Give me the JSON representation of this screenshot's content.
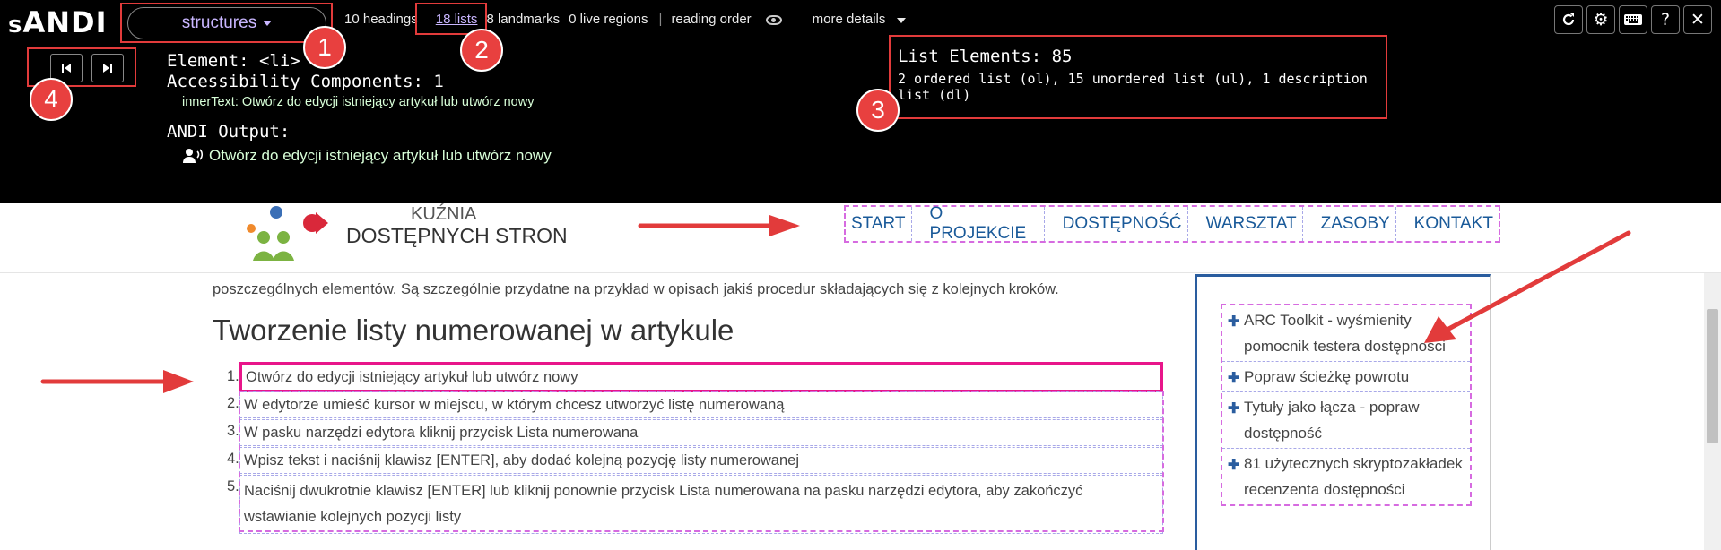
{
  "andi": {
    "logo_prefix": "s",
    "logo_main": "ANDI",
    "module": "structures",
    "summary": {
      "headings": "10 headings",
      "lists": "18 lists",
      "landmarks": "8 landmarks",
      "live_regions": "0 live regions",
      "reading_order": "reading order",
      "more_details": "more details"
    },
    "toolbar_icons": [
      "refresh-icon",
      "settings-icon",
      "keyboard-icon",
      "help-icon",
      "close-icon"
    ],
    "element_label": "Element: <li>",
    "components_label": "Accessibility Components: 1",
    "inner_text": "innerText: Otwórz do edycji istniejący artykuł lub utwórz nowy",
    "output_label": "ANDI Output:",
    "output_text": "Otwórz do edycji istniejący artykuł lub utwórz nowy",
    "list_elements_title": "List Elements: 85",
    "list_elements_detail": "2 ordered list (ol), 15 unordered list (ul), 1 description list (dl)",
    "badges": [
      "1",
      "2",
      "3",
      "4"
    ]
  },
  "site": {
    "logo_line1": "KUŹNIA",
    "logo_line2": "DOSTĘPNYCH STRON",
    "nav": [
      "START",
      "O PROJEKCIE",
      "DOSTĘPNOŚĆ",
      "WARSZTAT",
      "ZASOBY",
      "KONTAKT"
    ]
  },
  "article": {
    "intro": "poszczególnych elementów. Są szczególnie przydatne na przykład w opisach jakiś procedur składających się z kolejnych kroków.",
    "heading": "Tworzenie listy numerowanej w artykule",
    "steps": [
      {
        "num": "1.",
        "text": "Otwórz do edycji istniejący artykuł lub utwórz nowy"
      },
      {
        "num": "2.",
        "text": "W edytorze umieść kursor w miejscu, w którym chcesz utworzyć listę numerowaną"
      },
      {
        "num": "3.",
        "text": "W pasku narzędzi edytora kliknij przycisk Lista numerowana"
      },
      {
        "num": "4.",
        "text": "Wpisz tekst i naciśnij klawisz [ENTER], aby dodać kolejną pozycję listy numerowanej"
      },
      {
        "num": "5.",
        "text": "Naciśnij dwukrotnie klawisz [ENTER] lub kliknij ponownie przycisk Lista numerowana na pasku narzędzi edytora, aby zakończyć wstawianie kolejnych pozycji listy"
      }
    ]
  },
  "sidebar": {
    "items": [
      "ARC Toolkit - wyśmienity pomocnik testera dostępności",
      "Popraw ścieżkę powrotu",
      "Tytuły jako łącza - popraw dostępność",
      "81 użytecznych skryptozakładek recenzenta dostępności"
    ]
  },
  "colors": {
    "annotation_red": "#e23b3b",
    "focus_pink": "#e8158a",
    "list_outline": "#d66be0",
    "item_outline": "#a8a8e8",
    "andi_link": "#c9b6ff",
    "andi_output": "#d8ffd8",
    "nav_blue": "#1a5a99"
  }
}
